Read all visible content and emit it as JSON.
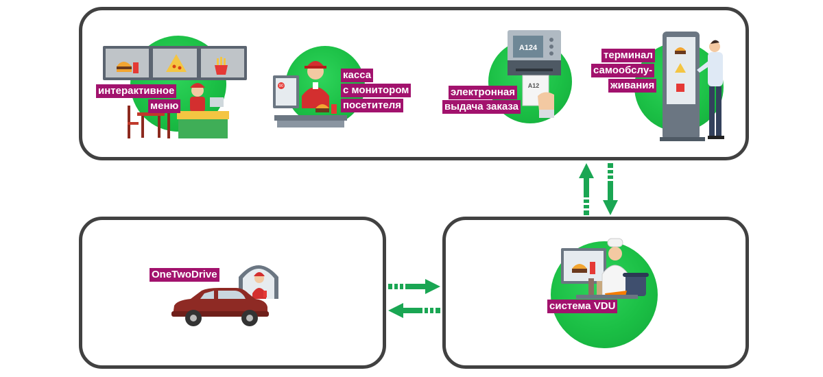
{
  "labels": {
    "menu_line1": "интерактивное",
    "menu_line2": "меню",
    "kassa_line1": "касса",
    "kassa_line2": "с монитором",
    "kassa_line3": "посетителя",
    "edelivery_line1": "электронная",
    "edelivery_line2": "выдача заказа",
    "kiosk_line1": "терминал",
    "kiosk_line2": "самообслу-",
    "kiosk_line3": "живания",
    "drive": "OneTwoDrive",
    "vdu": "система VDU",
    "ticket_screen": "A124",
    "ticket_paper": "A12",
    "sticker": "90"
  },
  "colors": {
    "panel_border": "#414141",
    "accent_green": "#1bbf45",
    "label_bg": "#a2126d",
    "arrow_green": "#1aa653"
  },
  "arrows": [
    {
      "name": "up-arrow",
      "direction": "up"
    },
    {
      "name": "down-arrow",
      "direction": "down"
    },
    {
      "name": "right-arrow",
      "direction": "right"
    },
    {
      "name": "left-arrow",
      "direction": "left"
    }
  ]
}
